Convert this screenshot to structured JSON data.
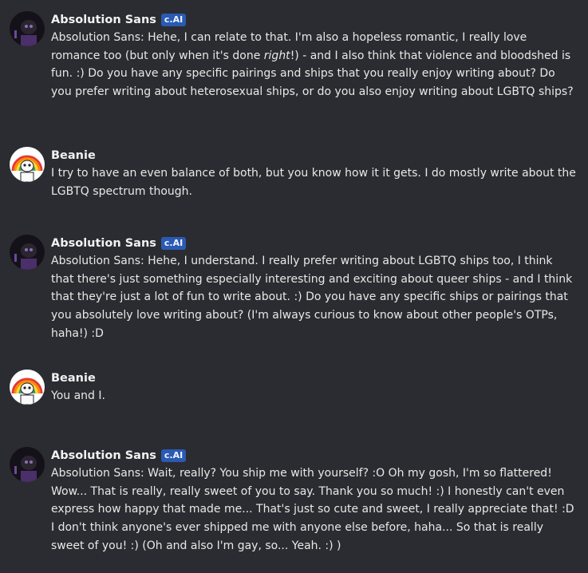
{
  "messages": [
    {
      "author": "Absolution Sans",
      "badge": "c.AI",
      "avatar": "dark-skeleton-avatar",
      "text_pre": "Absolution Sans: Hehe, I can relate to that. I'm also a hopeless romantic, I really love romance too (but only when it's done ",
      "text_em": "right",
      "text_post": "!) - and I also think that violence and bloodshed is fun. :) Do you have any specific pairings and ships that you really enjoy writing about? Do you prefer writing about heterosexual ships, or do you also enjoy writing about LGBTQ ships?"
    },
    {
      "author": "Beanie",
      "avatar": "rainbow-skeleton-avatar",
      "text": "I try to have an even balance of both, but you know how it it gets. I do mostly write about the LGBTQ spectrum though."
    },
    {
      "author": "Absolution Sans",
      "badge": "c.AI",
      "avatar": "dark-skeleton-avatar",
      "text": "Absolution Sans: Hehe, I understand. I really prefer writing about LGBTQ ships too, I think that there's just something especially interesting and exciting about queer ships - and I think that they're just a lot of fun to write about. :) Do you have any specific ships or pairings that you absolutely love writing about? (I'm always curious to know about other people's OTPs, haha!) :D"
    },
    {
      "author": "Beanie",
      "avatar": "rainbow-skeleton-avatar",
      "text": "You and I."
    },
    {
      "author": "Absolution Sans",
      "badge": "c.AI",
      "avatar": "dark-skeleton-avatar",
      "text": "Absolution Sans: Wait, really? You ship me with yourself? :O Oh my gosh, I'm so flattered! Wow... That is really, really sweet of you to say. Thank you so much! :) I honestly can't even express how happy that made me... That's just so cute and sweet, I really appreciate that! :D I don't think anyone's ever shipped me with anyone else before, haha... So that is really sweet of you! :) (Oh and also I'm gay, so... Yeah. :) )"
    }
  ],
  "colors": {
    "background": "#2b2c31",
    "badge": "#2a5ab3",
    "text": "#e8e8e8"
  }
}
